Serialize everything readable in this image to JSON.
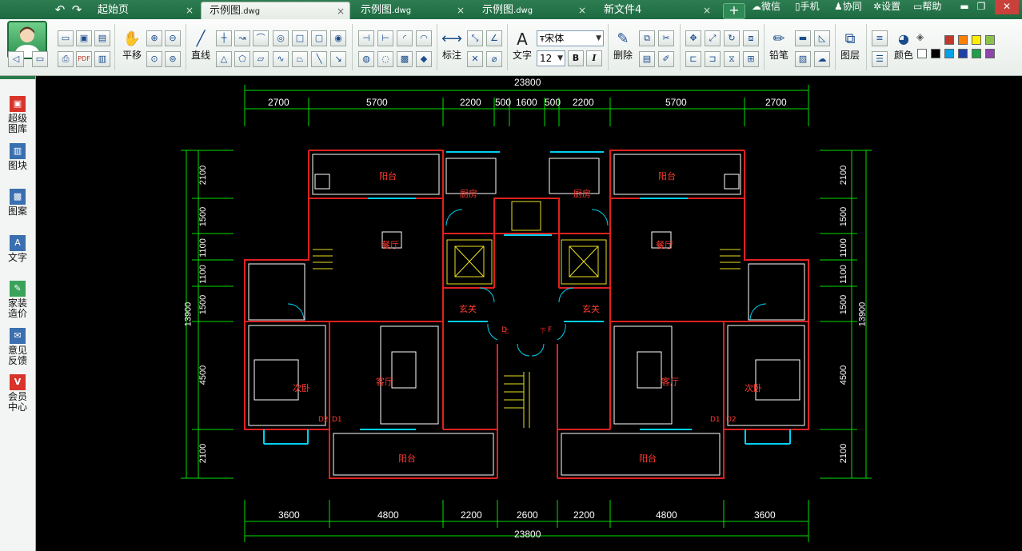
{
  "titlebar": {
    "undo_icon": "undo-arrow",
    "redo_icon": "redo-arrow",
    "tabs": [
      {
        "label": "起始页",
        "suffix": "",
        "active": false
      },
      {
        "label": "示例图",
        "suffix": ".dwg",
        "active": true
      },
      {
        "label": "示例图",
        "suffix": ".dwg",
        "active": false
      },
      {
        "label": "示例图",
        "suffix": ".dwg",
        "active": false
      },
      {
        "label": "新文件4",
        "suffix": "",
        "active": false
      }
    ],
    "close_glyph": "×",
    "new_tab_glyph": "+",
    "links": {
      "wechat": "微信",
      "phone": "手机",
      "collab": "协同",
      "settings": "设置",
      "help": "帮助"
    },
    "window_buttons": {
      "minimize": "▬",
      "restore": "❐",
      "close": "✕"
    }
  },
  "toolbar": {
    "pan_label": "平移",
    "line_label": "直线",
    "dimension_label": "标注",
    "text_label": "文字",
    "font_name": "宋体",
    "font_size": "12",
    "bold_label": "B",
    "italic_label": "I",
    "delete_label": "删除",
    "pencil_label": "铅笔",
    "layer_label": "图层",
    "color_label": "颜色",
    "colors": [
      "#ffffff",
      "#000000",
      "#c0392b",
      "#ff7f00",
      "#ffee00",
      "#8bc34a",
      "#00a2e8",
      "#1f3fa8",
      "#1e9e4a",
      "#8e44ad"
    ]
  },
  "sidebar": {
    "items": [
      {
        "label": "超级\n图库",
        "icon": "gallery-icon"
      },
      {
        "label": "图块",
        "icon": "block-icon"
      },
      {
        "label": "图案",
        "icon": "hatch-icon"
      },
      {
        "label": "文字",
        "icon": "text-icon"
      },
      {
        "label": "家装\n造价",
        "icon": "cost-icon"
      },
      {
        "label": "意见\n反馈",
        "icon": "feedback-icon"
      },
      {
        "label": "会员\n中心",
        "icon": "vip-icon"
      }
    ]
  },
  "drawing": {
    "total_top": "23800",
    "total_bottom": "23800",
    "top_dims": [
      "2700",
      "5700",
      "2200",
      "500",
      "1600",
      "500",
      "2200",
      "5700",
      "2700"
    ],
    "bottom_dims": [
      "3600",
      "4800",
      "2200",
      "2600",
      "2200",
      "4800",
      "3600"
    ],
    "left_dims": [
      "2100",
      "1500",
      "1100",
      "1100",
      "1500",
      "4500",
      "2100"
    ],
    "left_total": "13900",
    "right_dims": [
      "2100",
      "1500",
      "1100",
      "1100",
      "1500",
      "4500",
      "2100"
    ],
    "right_total": "13900",
    "rooms": {
      "balcony": "阳台",
      "kitchen": "厨房",
      "dining": "餐厅",
      "foyer": "玄关",
      "living": "客厅",
      "bedroom": "次卧",
      "up": "上",
      "down": "下",
      "door_d": "D",
      "door_f": "F",
      "d1": "D1",
      "d2": "D2"
    }
  }
}
